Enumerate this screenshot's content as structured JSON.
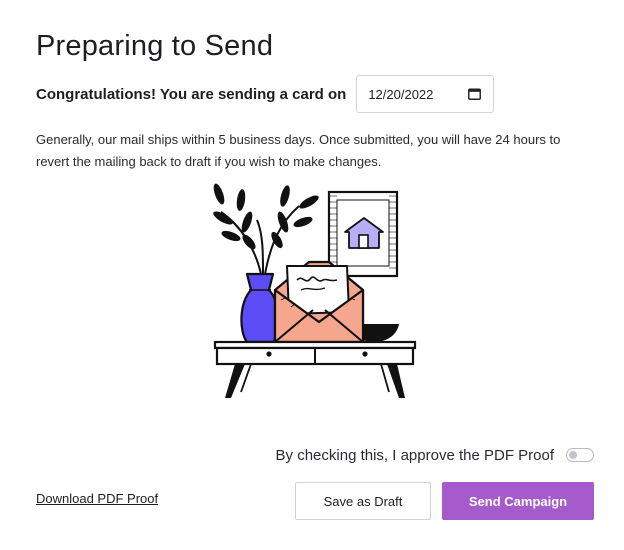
{
  "page": {
    "title": "Preparing to Send"
  },
  "scheduling": {
    "congrats_text": "Congratulations! You are sending a card on",
    "date_value": "12/20/2022",
    "calendar_icon": "calendar-icon"
  },
  "description": "Generally, our mail ships within 5 business days. Once submitted, you will have 24 hours to revert the mailing back to draft if you wish to make changes.",
  "illustration": {
    "subject": "envelope-on-table-illustration",
    "colors": {
      "vase": "#5b4cf5",
      "envelope": "#f6a68c",
      "house": "#b7aef7",
      "outline": "#111111"
    }
  },
  "approval": {
    "label": "By checking this, I approve the PDF Proof",
    "checked": false
  },
  "actions": {
    "download_label": "Download PDF Proof",
    "draft_label": "Save as Draft",
    "send_label": "Send Campaign",
    "send_color": "#a55bcb"
  }
}
